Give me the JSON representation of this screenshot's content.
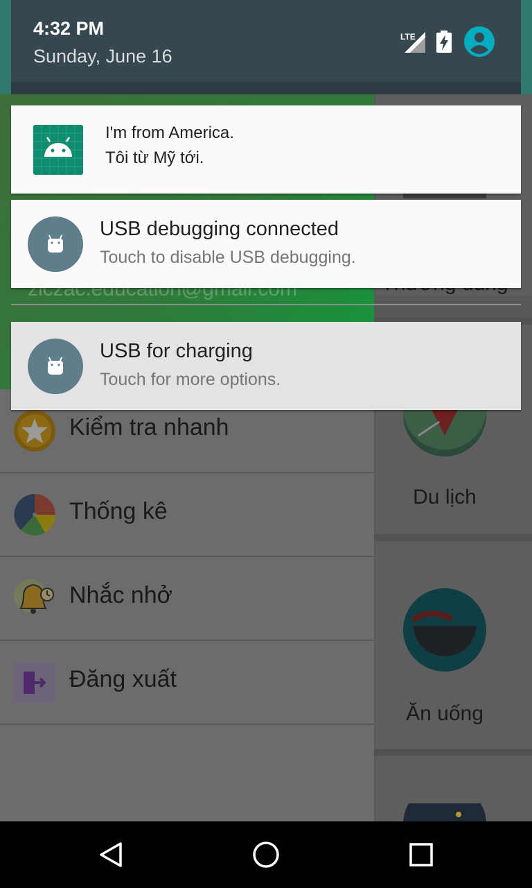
{
  "status_bar": {
    "time": "4:32 PM",
    "date": "Sunday, June 16",
    "network_label": "LTE",
    "icons": [
      "lte-signal-icon",
      "battery-charging-icon",
      "user-avatar-icon"
    ],
    "accent_avatar": "#00acc1"
  },
  "notifications": [
    {
      "id": "app",
      "icon": "android-app-icon",
      "line1": "I'm from America.",
      "line2": "Tôi từ Mỹ tới."
    },
    {
      "id": "usb-debug",
      "icon": "android-robot-icon",
      "title": "USB debugging connected",
      "subtitle": "Touch to disable USB debugging."
    },
    {
      "id": "usb-charge",
      "icon": "android-robot-icon",
      "title": "USB for charging",
      "subtitle": "Touch for more options."
    }
  ],
  "background_app": {
    "drawer_email": "ziczac.education@gmail.com",
    "menu": [
      {
        "label": "Kiểm tra nhanh",
        "icon": "star-icon"
      },
      {
        "label": "Thống kê",
        "icon": "pie-chart-icon"
      },
      {
        "label": "Nhắc nhở",
        "icon": "alarm-bell-icon"
      },
      {
        "label": "Đăng xuất",
        "icon": "logout-icon"
      }
    ],
    "right_panel": {
      "partial_label": "Thường dùng",
      "categories": [
        {
          "label": "Du lịch",
          "icon": "map-pin-icon"
        },
        {
          "label": "Ăn uống",
          "icon": "bowl-icon"
        }
      ]
    }
  },
  "nav_bar": {
    "buttons": [
      "back-icon",
      "home-icon",
      "recents-icon"
    ]
  },
  "colors": {
    "shade_header": "#37474f",
    "notification_bg": "#fafafa",
    "usb_icon_bg": "#607d8b",
    "app_icon_bg": "#0f8b6d"
  }
}
